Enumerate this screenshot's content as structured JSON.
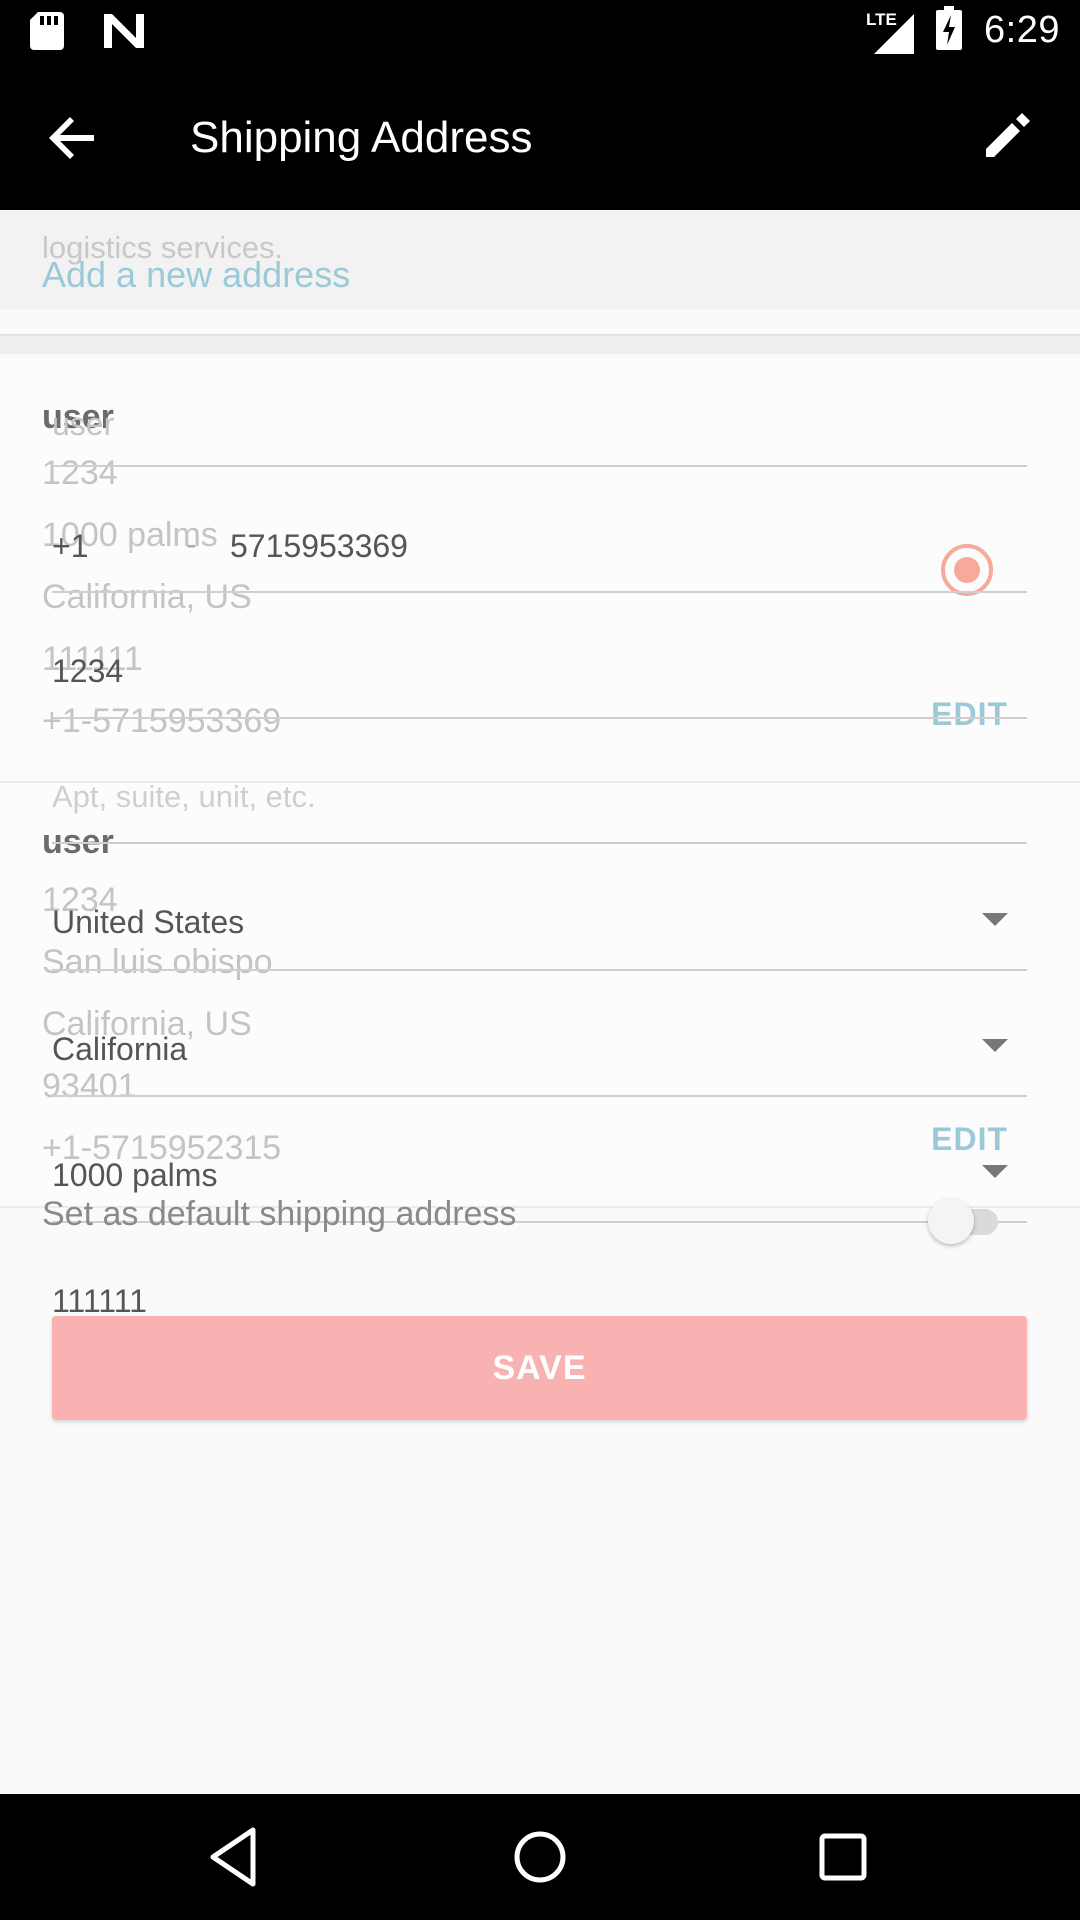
{
  "status_bar": {
    "time": "6:29",
    "network": "LTE"
  },
  "toolbar": {
    "title": "Shipping Address"
  },
  "address_list": {
    "hint_text": "logistics services.",
    "add_link": "Add a new address",
    "addresses": [
      {
        "name": "user",
        "street": "1234",
        "city_line": "1000 palms",
        "region": "California, US",
        "postal": "111111",
        "phone": "+1-5715953369",
        "edit_label": "EDIT",
        "selected": true
      },
      {
        "name": "user",
        "street": "1234",
        "city_line": "San luis obispo",
        "region": "California, US",
        "postal": "93401",
        "phone": "+1-5715952315",
        "edit_label": "EDIT",
        "selected": false
      }
    ]
  },
  "form": {
    "name_value": "user",
    "phone_code": "+1",
    "phone_separator": "-",
    "phone_number": "5715953369",
    "street_value": "1234",
    "apt_placeholder": "Apt, suite, unit, etc.",
    "country_value": "United States",
    "state_value": "California",
    "city_value": "1000 palms",
    "zip_value": "111111",
    "default_label": "Set as default shipping address",
    "default_on": false,
    "save_label": "SAVE"
  },
  "colors": {
    "accent_link": "#9cc9d8",
    "radio": "#f7a99a",
    "save_button": "#f8b2b1"
  }
}
